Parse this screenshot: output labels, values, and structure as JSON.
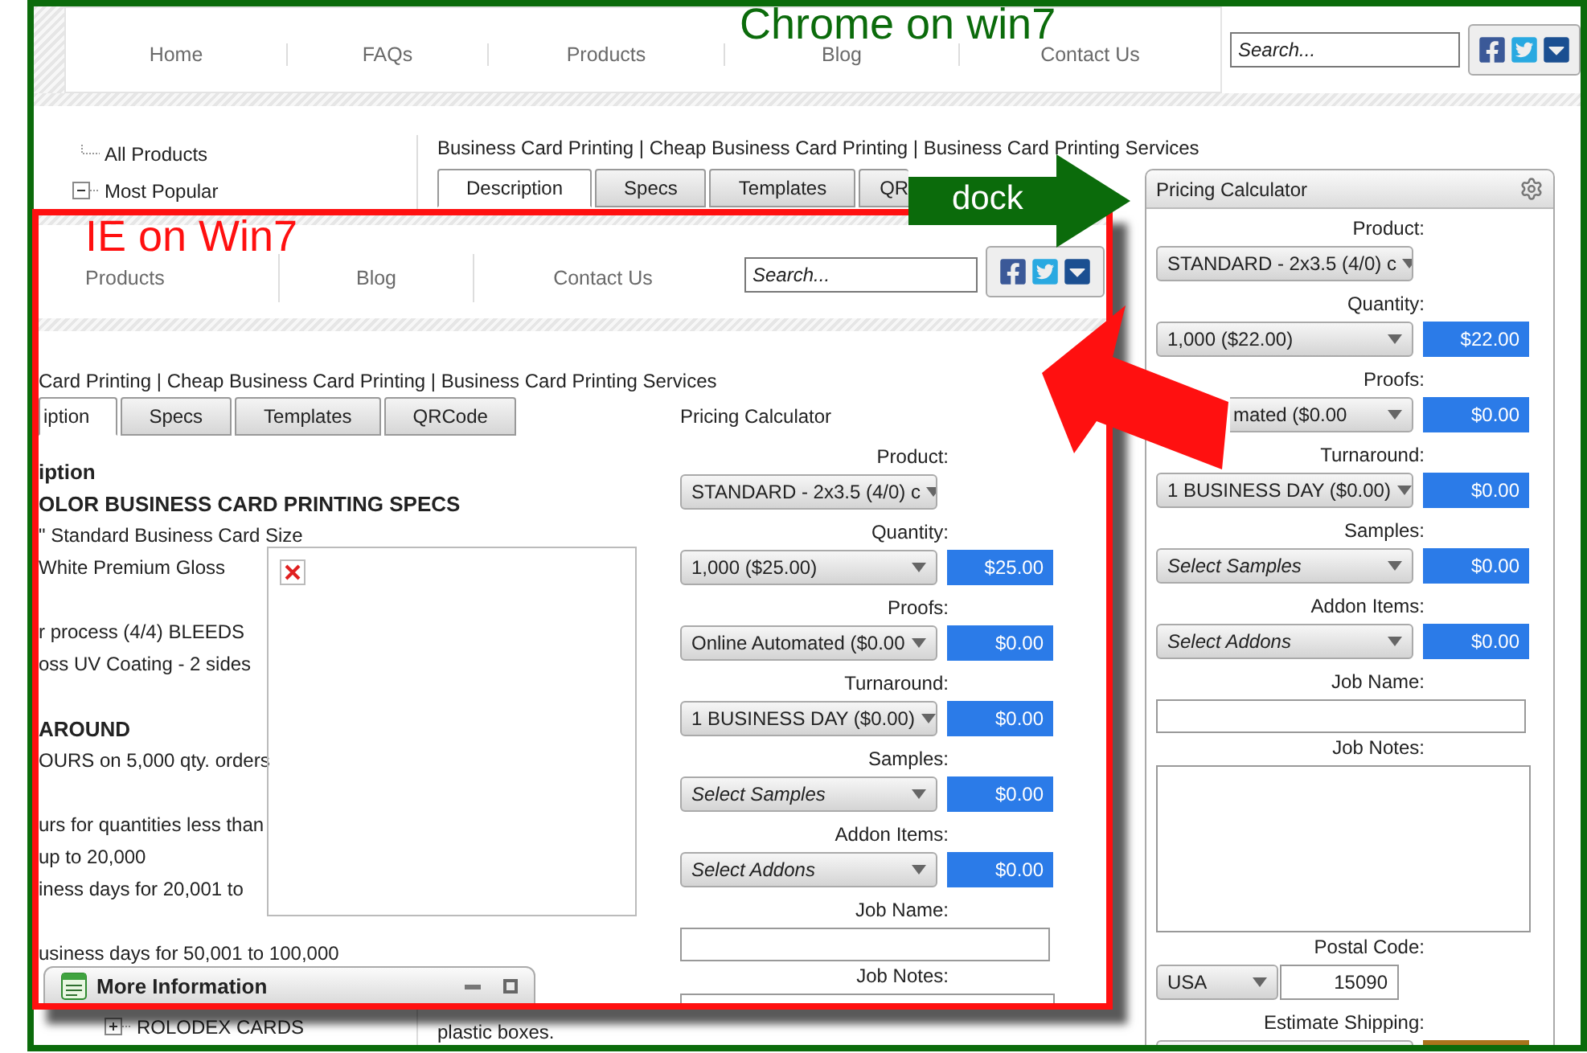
{
  "chrome_caption": "Chrome on win7",
  "ie_caption": "IE on Win7",
  "dock_arrow": {
    "label": "dock"
  },
  "chrome": {
    "nav": {
      "items": [
        "Home",
        "FAQs",
        "Products",
        "Blog",
        "Contact Us"
      ],
      "search_placeholder": "Search..."
    },
    "tree": [
      {
        "label": "All Products"
      },
      {
        "label": "Most Popular",
        "expanded": true,
        "children": [
          {
            "label": "ROLODEX CARDS",
            "expanded": false
          }
        ]
      }
    ],
    "breadcrumb": "Business Card Printing | Cheap Business Card Printing | Business Card Printing Services",
    "tabs": [
      {
        "label": "Description",
        "selected": true
      },
      {
        "label": "Specs",
        "selected": false
      },
      {
        "label": "Templates",
        "selected": false
      },
      {
        "label": "QR",
        "selected": false
      }
    ],
    "footer_text": "plastic boxes.",
    "pricing": {
      "title": "Pricing Calculator",
      "rows": [
        {
          "kind": "select",
          "label": "Product:",
          "value": "STANDARD - 2x3.5 (4/0) c"
        },
        {
          "kind": "select_price",
          "label": "Quantity:",
          "value": "1,000 ($22.00)",
          "price": "$22.00"
        },
        {
          "kind": "covered_select_price",
          "label": "Proofs:",
          "value": "mated ($0.00",
          "price": "$0.00"
        },
        {
          "kind": "select_price",
          "label": "Turnaround:",
          "value": "1 BUSINESS DAY ($0.00)",
          "price": "$0.00"
        },
        {
          "kind": "select_price",
          "label": "Samples:",
          "placeholder": "Select Samples",
          "price": "$0.00"
        },
        {
          "kind": "select_price",
          "label": "Addon Items:",
          "placeholder": "Select Addons",
          "price": "$0.00"
        },
        {
          "kind": "text",
          "label": "Job Name:"
        },
        {
          "kind": "textarea",
          "label": "Job Notes:"
        },
        {
          "kind": "postal",
          "label": "Postal Code:",
          "country": "USA",
          "value": "15090"
        },
        {
          "kind": "shipping",
          "label": "Estimate Shipping:"
        }
      ]
    }
  },
  "ie": {
    "nav": {
      "items": [
        "Products",
        "Blog",
        "Contact Us"
      ],
      "search_placeholder": "Search..."
    },
    "breadcrumb": "Card Printing | Cheap Business Card Printing | Business Card Printing Services",
    "tabs": [
      {
        "label": "iption",
        "selected": true
      },
      {
        "label": "Specs",
        "selected": false
      },
      {
        "label": "Templates",
        "selected": false
      },
      {
        "label": "QRCode",
        "selected": false
      }
    ],
    "description": {
      "heading": "iption",
      "sections": [
        {
          "title": "OLOR BUSINESS CARD PRINTING SPECS",
          "paragraphs": [
            [
              "\" Standard Business Card Size",
              "White Premium Gloss"
            ],
            [
              "r process (4/4) BLEEDS",
              "oss UV Coating - 2 sides"
            ]
          ]
        },
        {
          "title": "AROUND",
          "paragraphs": [
            [
              "OURS on 5,000 qty. orders"
            ],
            [
              "urs for quantities less than",
              "up to 20,000",
              "iness days for 20,001 to"
            ],
            [
              "usiness days for 50,001 to 100,000"
            ]
          ]
        }
      ]
    },
    "pricing": {
      "title": "Pricing Calculator",
      "rows": [
        {
          "kind": "select",
          "label": "Product:",
          "value": "STANDARD - 2x3.5 (4/0) c"
        },
        {
          "kind": "select_price",
          "label": "Quantity:",
          "value": "1,000 ($25.00)",
          "price": "$25.00"
        },
        {
          "kind": "select_price",
          "label": "Proofs:",
          "value": "Online Automated ($0.00",
          "price": "$0.00"
        },
        {
          "kind": "select_price",
          "label": "Turnaround:",
          "value": "1 BUSINESS DAY ($0.00)",
          "price": "$0.00"
        },
        {
          "kind": "select_price",
          "label": "Samples:",
          "placeholder": "Select Samples",
          "price": "$0.00"
        },
        {
          "kind": "select_price",
          "label": "Addon Items:",
          "placeholder": "Select Addons",
          "price": "$0.00"
        },
        {
          "kind": "text",
          "label": "Job Name:"
        },
        {
          "kind": "textarea",
          "label": "Job Notes:"
        }
      ]
    },
    "more_info": {
      "title": "More Information"
    }
  }
}
